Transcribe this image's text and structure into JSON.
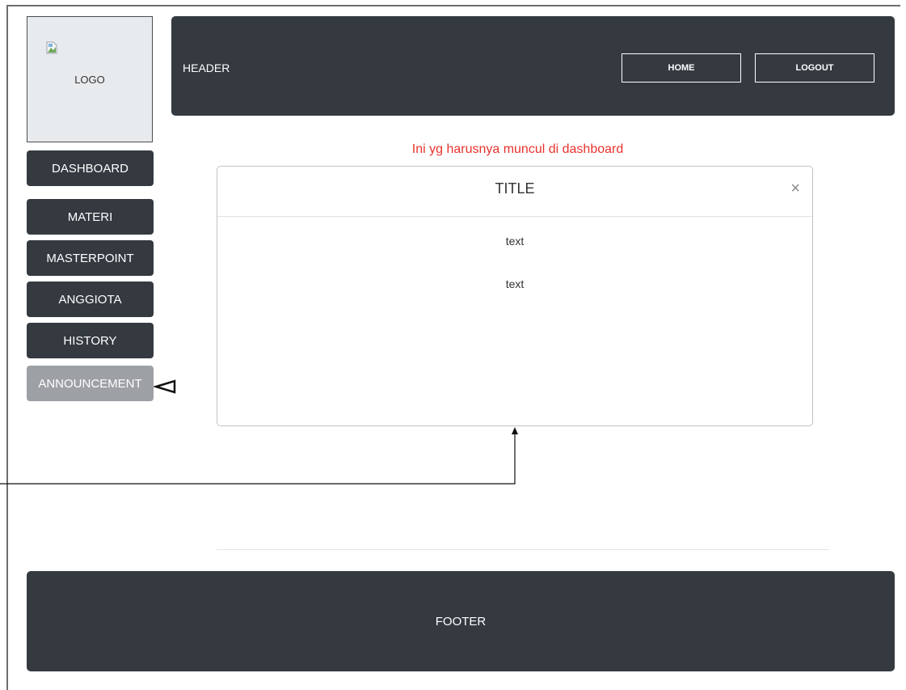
{
  "logo": {
    "label": "LOGO",
    "image_icon": "broken-image-icon"
  },
  "header": {
    "title": "HEADER",
    "buttons": {
      "home": "HOME",
      "logout": "LOGOUT"
    }
  },
  "sidebar": {
    "items": [
      {
        "label": "DASHBOARD",
        "active": false
      },
      {
        "label": "MATERI",
        "active": false
      },
      {
        "label": "MASTERPOINT",
        "active": false
      },
      {
        "label": "ANGGIOTA",
        "active": false
      },
      {
        "label": "HISTORY",
        "active": false
      },
      {
        "label": "ANNOUNCEMENT",
        "active": true
      }
    ]
  },
  "main": {
    "notice": "Ini yg harusnya muncul di dashboard",
    "modal": {
      "title": "TITLE",
      "close_icon": "×",
      "texts": [
        "text",
        "text"
      ]
    }
  },
  "footer": {
    "label": "FOOTER"
  },
  "colors": {
    "dark": "#343a40",
    "active_item": "#9da0a4",
    "notice": "#e8332e",
    "logo_bg": "#e8ebee"
  }
}
